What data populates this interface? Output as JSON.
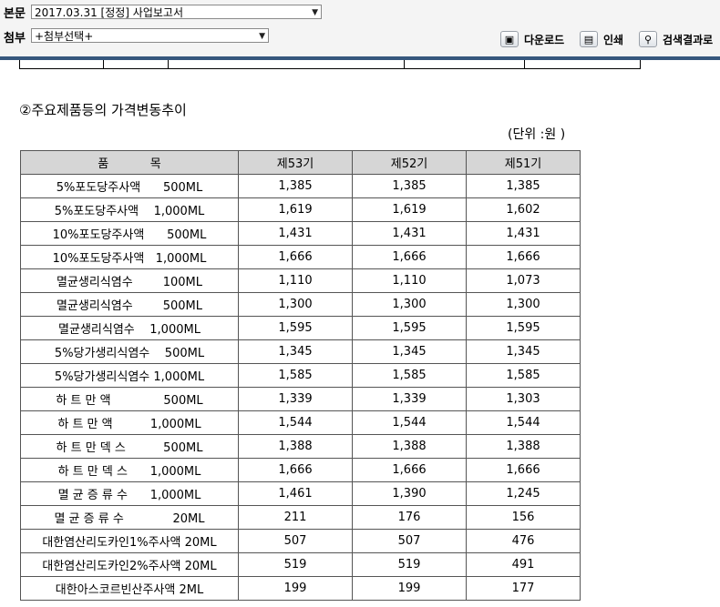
{
  "toolbar": {
    "main_label": "본문",
    "main_select": "2017.03.31  [정정] 사업보고서",
    "attach_label": "첨부",
    "attach_select": "+첨부선택+",
    "download_label": "다운로드",
    "print_label": "인쇄",
    "search_result_label": "검색결과로"
  },
  "section": {
    "title": "②주요제품등의 가격변동추이",
    "unit_note": "(단위 :원 )"
  },
  "table": {
    "headers": [
      "품           목",
      "제53기",
      "제52기",
      "제51기"
    ],
    "rows": [
      [
        "5%포도당주사액      500ML",
        "1,385",
        "1,385",
        "1,385"
      ],
      [
        "5%포도당주사액    1,000ML",
        "1,619",
        "1,619",
        "1,602"
      ],
      [
        "10%포도당주사액      500ML",
        "1,431",
        "1,431",
        "1,431"
      ],
      [
        "10%포도당주사액   1,000ML",
        "1,666",
        "1,666",
        "1,666"
      ],
      [
        "멸균생리식염수        100ML",
        "1,110",
        "1,110",
        "1,073"
      ],
      [
        "멸균생리식염수        500ML",
        "1,300",
        "1,300",
        "1,300"
      ],
      [
        "멸균생리식염수    1,000ML",
        "1,595",
        "1,595",
        "1,595"
      ],
      [
        "5%당가생리식염수    500ML",
        "1,345",
        "1,345",
        "1,345"
      ],
      [
        "5%당가생리식염수 1,000ML",
        "1,585",
        "1,585",
        "1,585"
      ],
      [
        "하 트 만 액              500ML",
        "1,339",
        "1,339",
        "1,303"
      ],
      [
        "하 트 만 액          1,000ML",
        "1,544",
        "1,544",
        "1,544"
      ],
      [
        "하 트 만 덱 스          500ML",
        "1,388",
        "1,388",
        "1,388"
      ],
      [
        "하 트 만 덱 스      1,000ML",
        "1,666",
        "1,666",
        "1,666"
      ],
      [
        "멸 균 증 류 수      1,000ML",
        "1,461",
        "1,390",
        "1,245"
      ],
      [
        "멸 균 증 류 수             20ML",
        "211",
        "176",
        "156"
      ],
      [
        "대한염산리도카인1%주사액 20ML",
        "507",
        "507",
        "476"
      ],
      [
        "대한염산리도카인2%주사액 20ML",
        "519",
        "519",
        "491"
      ],
      [
        "대한아스코르빈산주사액 2ML",
        "199",
        "199",
        "177"
      ]
    ]
  }
}
